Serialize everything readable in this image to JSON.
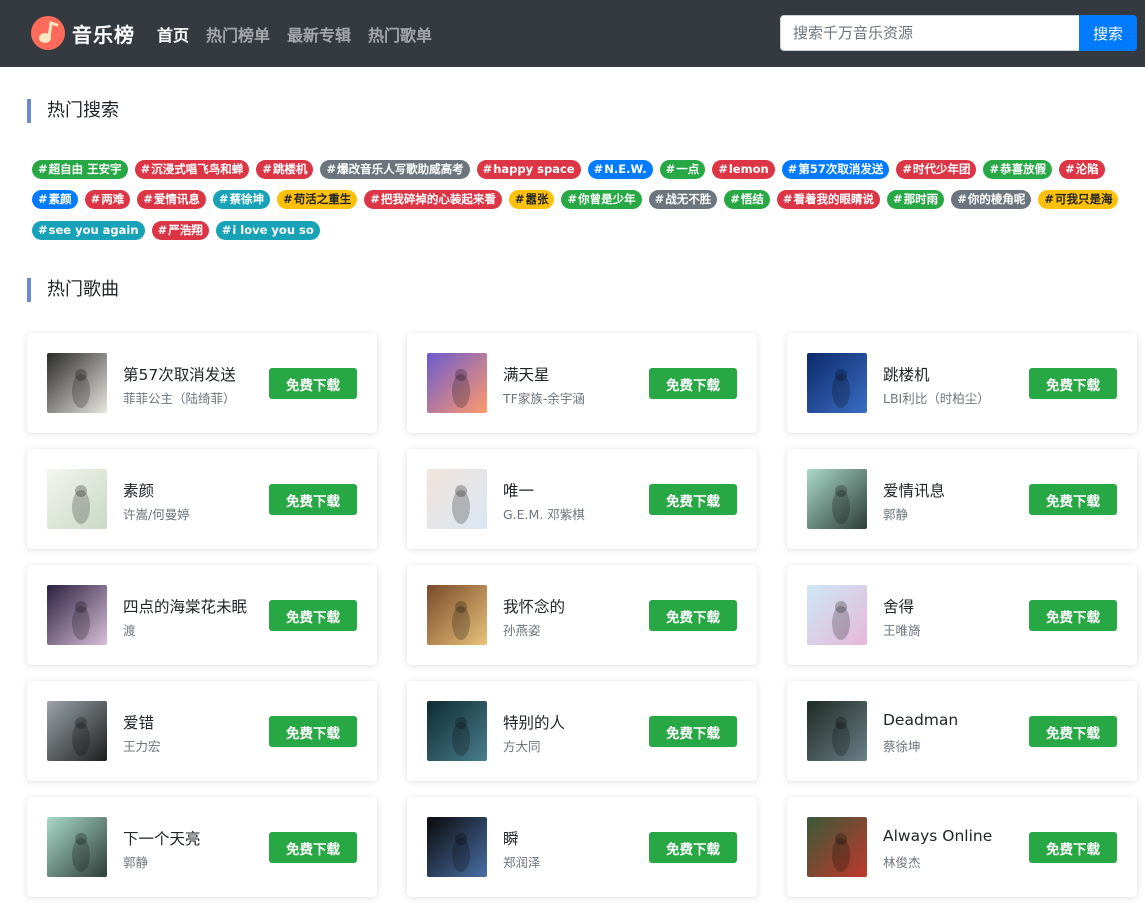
{
  "brand": {
    "name": "音乐榜",
    "logo_icon": "music-note-icon",
    "logo_color": "#ff6b5b"
  },
  "nav": [
    {
      "label": "首页",
      "active": true
    },
    {
      "label": "热门榜单",
      "active": false
    },
    {
      "label": "最新专辑",
      "active": false
    },
    {
      "label": "热门歌单",
      "active": false
    }
  ],
  "search": {
    "placeholder": "搜索千万音乐资源",
    "button_label": "搜索"
  },
  "hot_search": {
    "title": "热门搜索",
    "rows": [
      [
        {
          "text": "超自由 王安宇",
          "color": "#28a745"
        },
        {
          "text": "沉浸式唱飞鸟和蝉",
          "color": "#dc3545"
        },
        {
          "text": "跳楼机",
          "color": "#dc3545"
        },
        {
          "text": "爆改音乐人写歌助威高考",
          "color": "#6c757d"
        },
        {
          "text": "happy space",
          "color": "#dc3545"
        },
        {
          "text": "N.E.W.",
          "color": "#007bff"
        },
        {
          "text": "一点",
          "color": "#28a745"
        },
        {
          "text": "lemon",
          "color": "#dc3545"
        },
        {
          "text": "第57次取消发送",
          "color": "#007bff"
        },
        {
          "text": "时代少年团",
          "color": "#dc3545"
        },
        {
          "text": "恭喜放假",
          "color": "#28a745"
        },
        {
          "text": "沦陷",
          "color": "#dc3545"
        }
      ],
      [
        {
          "text": "素颜",
          "color": "#007bff"
        },
        {
          "text": "两难",
          "color": "#dc3545"
        },
        {
          "text": "爱情讯息",
          "color": "#dc3545"
        },
        {
          "text": "蔡徐坤",
          "color": "#17a2b8"
        },
        {
          "text": "苟活之重生",
          "color": "#ffc107",
          "dark": true
        },
        {
          "text": "把我碎掉的心装起来看",
          "color": "#dc3545"
        },
        {
          "text": "嚣张",
          "color": "#ffc107",
          "dark": true
        },
        {
          "text": "你曾是少年",
          "color": "#28a745"
        },
        {
          "text": "战无不胜",
          "color": "#6c757d"
        },
        {
          "text": "悟结",
          "color": "#28a745"
        },
        {
          "text": "看着我的眼睛说",
          "color": "#dc3545"
        },
        {
          "text": "那时雨",
          "color": "#28a745"
        },
        {
          "text": "你的棱角呢",
          "color": "#6c757d"
        },
        {
          "text": "可我只是海",
          "color": "#ffc107",
          "dark": true
        }
      ],
      [
        {
          "text": "see you again",
          "color": "#17a2b8"
        },
        {
          "text": "严浩翔",
          "color": "#dc3545"
        },
        {
          "text": "i love you so",
          "color": "#17a2b8"
        }
      ]
    ]
  },
  "hot_songs": {
    "title": "热门歌曲",
    "download_label": "免费下载",
    "songs": [
      {
        "title": "第57次取消发送",
        "artist": "菲菲公主（陆绮菲）",
        "cover": [
          "#2a2a2a",
          "#e8e6e0"
        ]
      },
      {
        "title": "满天星",
        "artist": "TF家族-余宇涵",
        "cover": [
          "#6a5acd",
          "#ff9a6c"
        ]
      },
      {
        "title": "跳楼机",
        "artist": "LBI利比（时柏尘）",
        "cover": [
          "#0d2a6b",
          "#3a6ec4"
        ]
      },
      {
        "title": "素颜",
        "artist": "许嵩/何曼婷",
        "cover": [
          "#f4f4ef",
          "#c9d9c4"
        ]
      },
      {
        "title": "唯一",
        "artist": "G.E.M. 邓紫棋",
        "cover": [
          "#f2e4dc",
          "#d9e6f2"
        ]
      },
      {
        "title": "爱情讯息",
        "artist": "郭静",
        "cover": [
          "#a9d9c8",
          "#2d3d38"
        ]
      },
      {
        "title": "四点的海棠花未眠",
        "artist": "渡",
        "cover": [
          "#2b2040",
          "#d8bfd8"
        ]
      },
      {
        "title": "我怀念的",
        "artist": "孙燕姿",
        "cover": [
          "#7a4a2a",
          "#e8c27a"
        ]
      },
      {
        "title": "舍得",
        "artist": "王唯旖",
        "cover": [
          "#cde7f5",
          "#e6b8d9"
        ]
      },
      {
        "title": "爱错",
        "artist": "王力宏",
        "cover": [
          "#9aa4aa",
          "#1e1e1e"
        ]
      },
      {
        "title": "特别的人",
        "artist": "方大同",
        "cover": [
          "#0e2b33",
          "#4a7d8c"
        ]
      },
      {
        "title": "Deadman",
        "artist": "蔡徐坤",
        "cover": [
          "#1f2b24",
          "#6b7f88"
        ]
      },
      {
        "title": "下一个天亮",
        "artist": "郭静",
        "cover": [
          "#a9d9c8",
          "#2d3d38"
        ]
      },
      {
        "title": "瞬",
        "artist": "郑润泽",
        "cover": [
          "#0a0a0a",
          "#4a6fa5"
        ]
      },
      {
        "title": "Always Online",
        "artist": "林俊杰",
        "cover": [
          "#3a5a3a",
          "#c0392b"
        ]
      }
    ]
  }
}
